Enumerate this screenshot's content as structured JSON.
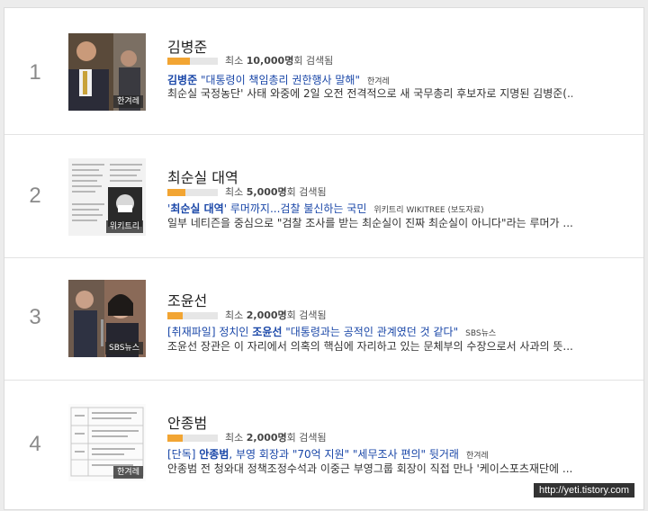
{
  "items": [
    {
      "rank": "1",
      "title": "김병준",
      "gauge_fraction": 0.45,
      "count_prefix": "최소 ",
      "count": "10,000명",
      "count_suffix": "회 검색됨",
      "headline_keyword": "김병준",
      "headline_rest": " \"대통령이 책임총리 권한행사 말해\"",
      "press": "한겨레",
      "snippet": "최순실 국정농단' 사태 와중에 2일 오전 전격적으로 새 국무총리 후보자로 지명된 김병준(...",
      "thumb_source": "한겨레"
    },
    {
      "rank": "2",
      "title": "최순실 대역",
      "gauge_fraction": 0.35,
      "count_prefix": "최소 ",
      "count": "5,000명",
      "count_suffix": "회 검색됨",
      "headline_pre": "'",
      "headline_keyword": "최순실 대역",
      "headline_rest": "' 루머까지...검찰 불신하는 국민",
      "press": "위키트리 WIKITREE (보도자료)",
      "snippet": "일부 네티즌을 중심으로 \"검찰 조사를 받는 최순실이 진짜 최순실이 아니다\"라는 루머가 ...",
      "thumb_source": "위키트리"
    },
    {
      "rank": "3",
      "title": "조윤선",
      "gauge_fraction": 0.3,
      "count_prefix": "최소 ",
      "count": "2,000명",
      "count_suffix": "회 검색됨",
      "headline_pre": "[취재파일] 정치인 ",
      "headline_keyword": "조윤선",
      "headline_rest": " \"대통령과는 공적인 관계였던 것 같다\"",
      "press": "SBS뉴스",
      "snippet": "조윤선 장관은 이 자리에서 의혹의 핵심에 자리하고 있는 문체부의 수장으로서 사과의 뜻...",
      "thumb_source": "SBS뉴스"
    },
    {
      "rank": "4",
      "title": "안종범",
      "gauge_fraction": 0.3,
      "count_prefix": "최소 ",
      "count": "2,000명",
      "count_suffix": "회 검색됨",
      "headline_pre": "[단독] ",
      "headline_keyword": "안종범",
      "headline_rest": ", 부영 회장과 \"70억 지원\" \"세무조사 편의\" 뒷거래",
      "press": "한겨레",
      "snippet": "안종범 전 청와대 정책조정수석과 이중근 부영그룹 회장이 직접 만나 '케이스포츠재단에 ...",
      "thumb_source": "한겨레"
    }
  ],
  "watermark": "http://yeti.tistory.com",
  "colors": {
    "headline": "#1a47a8",
    "gauge_fill": "#f2a533",
    "gauge_bg": "#e6e6e6"
  }
}
